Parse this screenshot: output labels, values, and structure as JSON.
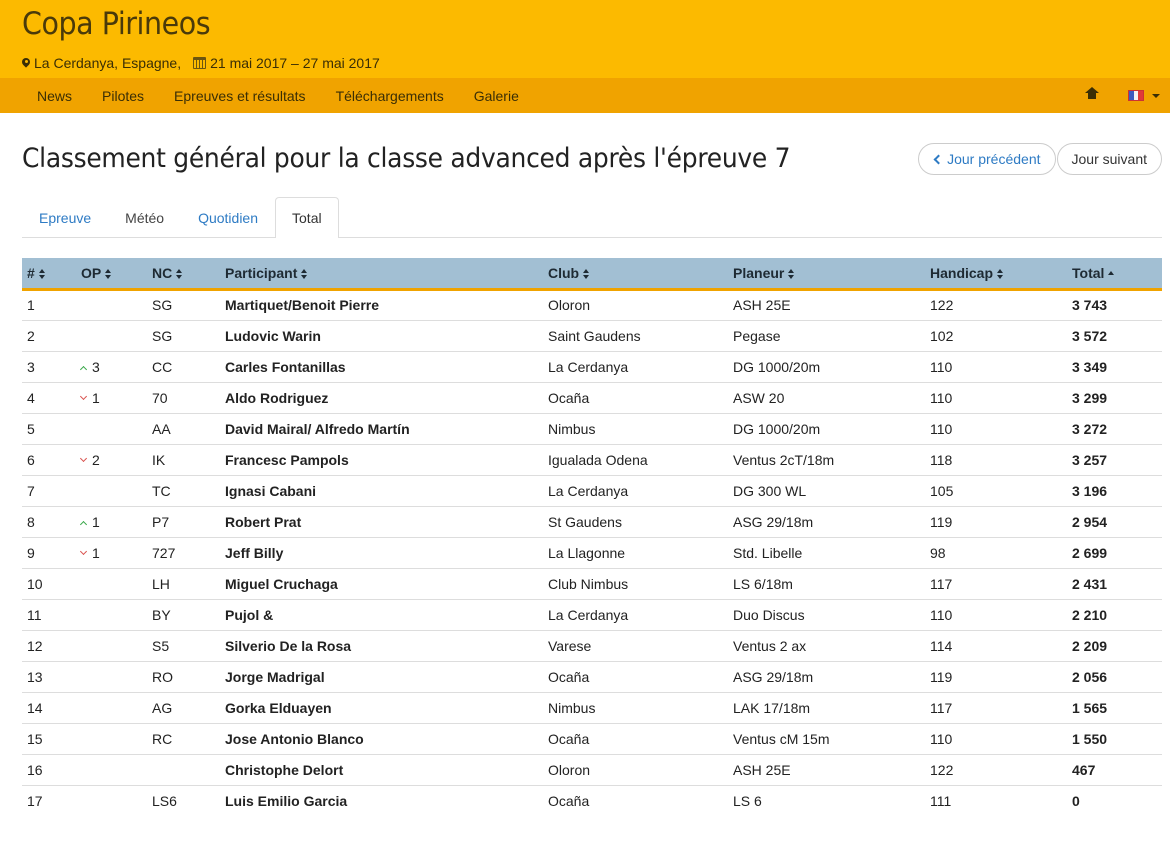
{
  "header": {
    "site_title": "Copa Pirineos",
    "location": "La Cerdanya, Espagne,",
    "dates": "21 mai 2017 – 27 mai 2017"
  },
  "nav": {
    "items": [
      {
        "label": "News"
      },
      {
        "label": "Pilotes"
      },
      {
        "label": "Epreuves et résultats"
      },
      {
        "label": "Téléchargements"
      },
      {
        "label": "Galerie"
      }
    ],
    "home_icon": "home-icon",
    "language_flag": "flag-fr-icon"
  },
  "page": {
    "title": "Classement général pour la classe advanced après l'épreuve 7",
    "prev_day_label": "Jour précédent",
    "next_day_label": "Jour suivant"
  },
  "tabs": [
    {
      "label": "Epreuve",
      "active": false
    },
    {
      "label": "Météo",
      "active": false
    },
    {
      "label": "Quotidien",
      "active": false
    },
    {
      "label": "Total",
      "active": true
    }
  ],
  "colors": {
    "header_bg": "#fcba00",
    "nav_bg": "#f0a300",
    "table_header_bg": "#a2bfd3",
    "link": "#2e7bc4",
    "rank_up": "#3aa84a",
    "rank_down": "#d9534f"
  },
  "table": {
    "columns": [
      "#",
      "OP",
      "NC",
      "Participant",
      "Club",
      "Planeur",
      "Handicap",
      "Total"
    ],
    "sorted_by": "Total",
    "rows": [
      {
        "rank": "1",
        "op_dir": "",
        "op": "",
        "nc": "SG",
        "participant": "Martiquet/Benoit Pierre",
        "club": "Oloron",
        "planeur": "ASH 25E",
        "handicap": "122",
        "total": "3 743"
      },
      {
        "rank": "2",
        "op_dir": "",
        "op": "",
        "nc": "SG",
        "participant": "Ludovic Warin",
        "club": "Saint Gaudens",
        "planeur": "Pegase",
        "handicap": "102",
        "total": "3 572"
      },
      {
        "rank": "3",
        "op_dir": "up",
        "op": "3",
        "nc": "CC",
        "participant": "Carles Fontanillas",
        "club": "La Cerdanya",
        "planeur": "DG 1000/20m",
        "handicap": "110",
        "total": "3 349"
      },
      {
        "rank": "4",
        "op_dir": "down",
        "op": "1",
        "nc": "70",
        "participant": "Aldo Rodriguez",
        "club": "Ocaña",
        "planeur": "ASW 20",
        "handicap": "110",
        "total": "3 299"
      },
      {
        "rank": "5",
        "op_dir": "",
        "op": "",
        "nc": "AA",
        "participant": "David Mairal/ Alfredo Martín",
        "club": "Nimbus",
        "planeur": "DG 1000/20m",
        "handicap": "110",
        "total": "3 272"
      },
      {
        "rank": "6",
        "op_dir": "down",
        "op": "2",
        "nc": "IK",
        "participant": "Francesc Pampols",
        "club": "Igualada Odena",
        "planeur": "Ventus 2cT/18m",
        "handicap": "118",
        "total": "3 257"
      },
      {
        "rank": "7",
        "op_dir": "",
        "op": "",
        "nc": "TC",
        "participant": "Ignasi Cabani",
        "club": "La Cerdanya",
        "planeur": "DG 300 WL",
        "handicap": "105",
        "total": "3 196"
      },
      {
        "rank": "8",
        "op_dir": "up",
        "op": "1",
        "nc": "P7",
        "participant": "Robert Prat",
        "club": "St Gaudens",
        "planeur": "ASG 29/18m",
        "handicap": "119",
        "total": "2 954"
      },
      {
        "rank": "9",
        "op_dir": "down",
        "op": "1",
        "nc": "727",
        "participant": "Jeff Billy",
        "club": "La Llagonne",
        "planeur": "Std. Libelle",
        "handicap": "98",
        "total": "2 699"
      },
      {
        "rank": "10",
        "op_dir": "",
        "op": "",
        "nc": "LH",
        "participant": "Miguel Cruchaga",
        "club": "Club Nimbus",
        "planeur": "LS 6/18m",
        "handicap": "117",
        "total": "2 431"
      },
      {
        "rank": "11",
        "op_dir": "",
        "op": "",
        "nc": "BY",
        "participant": "Pujol &",
        "club": "La Cerdanya",
        "planeur": "Duo Discus",
        "handicap": "110",
        "total": "2 210"
      },
      {
        "rank": "12",
        "op_dir": "",
        "op": "",
        "nc": "S5",
        "participant": "Silverio De la Rosa",
        "club": "Varese",
        "planeur": "Ventus 2 ax",
        "handicap": "114",
        "total": "2 209"
      },
      {
        "rank": "13",
        "op_dir": "",
        "op": "",
        "nc": "RO",
        "participant": "Jorge Madrigal",
        "club": "Ocaña",
        "planeur": "ASG 29/18m",
        "handicap": "119",
        "total": "2 056"
      },
      {
        "rank": "14",
        "op_dir": "",
        "op": "",
        "nc": "AG",
        "participant": "Gorka Elduayen",
        "club": "Nimbus",
        "planeur": "LAK 17/18m",
        "handicap": "117",
        "total": "1 565"
      },
      {
        "rank": "15",
        "op_dir": "",
        "op": "",
        "nc": "RC",
        "participant": "Jose Antonio Blanco",
        "club": "Ocaña",
        "planeur": "Ventus cM 15m",
        "handicap": "110",
        "total": "1 550"
      },
      {
        "rank": "16",
        "op_dir": "",
        "op": "",
        "nc": "",
        "participant": "Christophe Delort",
        "club": "Oloron",
        "planeur": "ASH 25E",
        "handicap": "122",
        "total": "467"
      },
      {
        "rank": "17",
        "op_dir": "",
        "op": "",
        "nc": "LS6",
        "participant": "Luis Emilio Garcia",
        "club": "Ocaña",
        "planeur": "LS 6",
        "handicap": "111",
        "total": "0"
      }
    ]
  }
}
